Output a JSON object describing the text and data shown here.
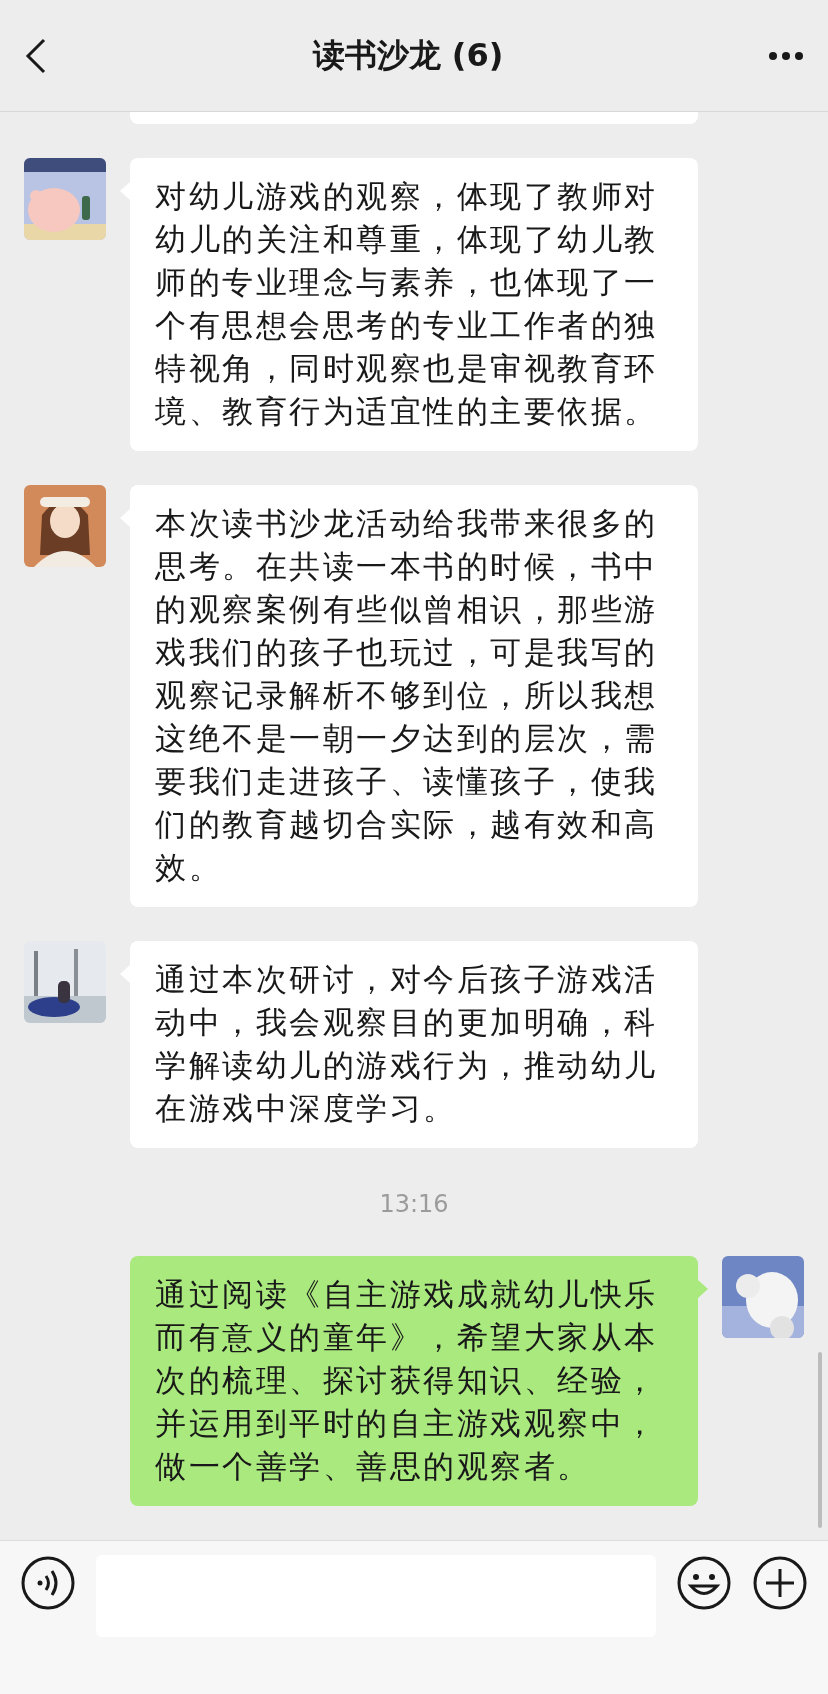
{
  "header": {
    "title": "读书沙龙 (6)"
  },
  "messages": [
    {
      "kind": "partial"
    },
    {
      "kind": "received",
      "text": "对幼儿游戏的观察，体现了教师对幼儿的关注和尊重，体现了幼儿教师的专业理念与素养，也体现了一个有思想会思考的专业工作者的独特视角，同时观察也是审视教育环境、教育行为适宜性的主要依据。"
    },
    {
      "kind": "received",
      "text": "本次读书沙龙活动给我带来很多的思考。在共读一本书的时候，书中的观察案例有些似曾相识，那些游戏我们的孩子也玩过，可是我写的观察记录解析不够到位，所以我想这绝不是一朝一夕达到的层次，需要我们走进孩子、读懂孩子，使我们的教育越切合实际，越有效和高效。"
    },
    {
      "kind": "received",
      "text": "通过本次研讨，对今后孩子游戏活动中，我会观察目的更加明确，科学解读幼儿的游戏行为，推动幼儿在游戏中深度学习。"
    },
    {
      "kind": "time",
      "text": "13:16"
    },
    {
      "kind": "sent",
      "text": "通过阅读《自主游戏成就幼儿快乐而有意义的童年》，希望大家从本次的梳理、探讨获得知识、经验，并运用到平时的自主游戏观察中，做一个善学、善思的观察者。"
    }
  ]
}
